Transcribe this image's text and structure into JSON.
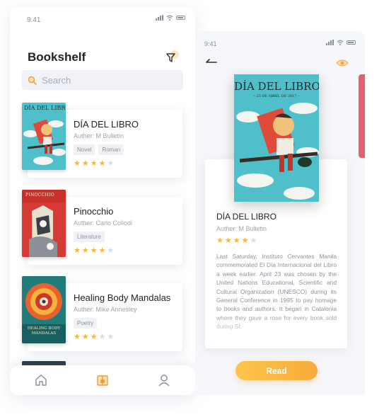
{
  "left_screen": {
    "status_time": "9:41",
    "title": "Bookshelf",
    "search_placeholder": "Search",
    "books": [
      {
        "title": "DÍA DEL LIBRO",
        "author": "Auther: M Bulletin",
        "tags": [
          "Novel",
          "Roman"
        ],
        "rating": 4,
        "cover_text": "DÍA DEL LIBRO"
      },
      {
        "title": "Pinocchio",
        "author": "Auther: Carlo Collodi",
        "tags": [
          "Literature"
        ],
        "rating": 4,
        "cover_text": "PINOCCHIO"
      },
      {
        "title": "Healing Body Mandalas",
        "author": "Auther: Mike Annesley",
        "tags": [
          "Poetry"
        ],
        "rating": 3,
        "cover_text": "HEALING BODY MANDALAS"
      }
    ],
    "tabbar": [
      "home-icon",
      "bookshelf-icon",
      "profile-icon"
    ]
  },
  "right_screen": {
    "status_time": "9:41",
    "cover_title": "DÍA DEL LIBRO",
    "cover_subtitle": "– 23 DE ABRIL DE 2017 –",
    "book_title": "DÍA DEL LIBRO",
    "author": "Auther: M Bulletin",
    "rating": 4,
    "description": "Last Saturday, Instituto Cervantes Manila commemorated El Día Internacional del Libro a week earlier. April 23 was chosen by the United Nations Educational, Scientific and Cultural Organization (UNESCO) during its General Conference in 1995 to pay homage to books and authors. It began in Catalonia where they gave a rose for every book sold during St.",
    "read_button": "Read"
  },
  "colors": {
    "accent": "#f9a93b",
    "star": "#f7b733",
    "scroll_tab": "#e4616e"
  }
}
